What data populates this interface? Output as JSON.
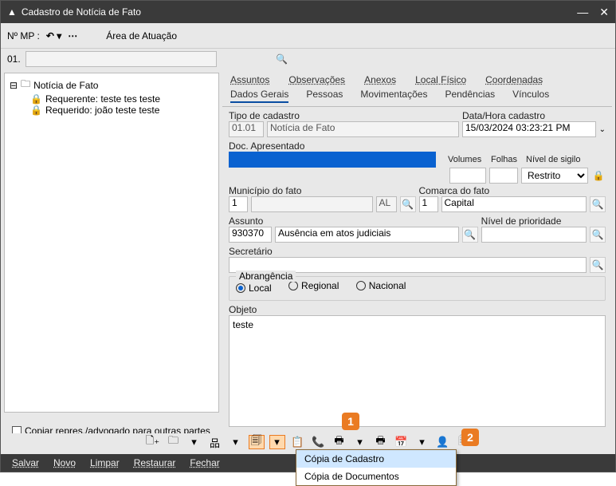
{
  "title": "Cadastro de Notícia de Fato",
  "topbar": {
    "nmp_label": "Nº MP :",
    "area_label": "Área de Atuação"
  },
  "idrow": {
    "prefix": "01."
  },
  "tree": {
    "root": "Notícia de Fato",
    "child1": "Requerente: teste tes teste",
    "child2": "Requerido: joão teste teste"
  },
  "tabsTop": {
    "assuntos": "Assuntos",
    "observacoes": "Observações",
    "anexos": "Anexos",
    "localfisico": "Local Físico",
    "coordenadas": "Coordenadas"
  },
  "tabsBottom": {
    "dadosgerais": "Dados Gerais",
    "pessoas": "Pessoas",
    "movimentacoes": "Movimentações",
    "pendencias": "Pendências",
    "vinculos": "Vínculos"
  },
  "form": {
    "tipoCadastroLabel": "Tipo de cadastro",
    "tipoCadastroCode": "01.01",
    "tipoCadastroDesc": "Notícia de Fato",
    "dataHoraLabel": "Data/Hora cadastro",
    "dataHora": "15/03/2024 03:23:21 PM",
    "docApresentadoLabel": "Doc. Apresentado",
    "volumesLabel": "Volumes",
    "folhasLabel": "Folhas",
    "sigiloLabel": "Nível de sigilo",
    "sigiloValue": "Restrito",
    "municipioLabel": "Município do fato",
    "municipioCode": "1",
    "municipioUF": "AL",
    "comarcaLabel": "Comarca do fato",
    "comarcaCode": "1",
    "comarcaDesc": "Capital",
    "assuntoLabel": "Assunto",
    "assuntoCode": "930370",
    "assuntoDesc": "Ausência em atos judiciais",
    "prioridadeLabel": "Nível de prioridade",
    "secretarioLabel": "Secretário",
    "abrangLabel": "Abrangência",
    "abrangLocal": "Local",
    "abrangRegional": "Regional",
    "abrangNacional": "Nacional",
    "objetoLabel": "Objeto",
    "objetoValue": "teste"
  },
  "copiar": "Copiar repres./advogado para outras partes",
  "bottom": {
    "salvar": "Salvar",
    "novo": "Novo",
    "limpar": "Limpar",
    "restaurar": "Restaurar",
    "fechar": "Fechar"
  },
  "popup": {
    "item1": "Cópia de Cadastro",
    "item2": "Cópia de Documentos"
  },
  "callout1": "1",
  "callout2": "2"
}
